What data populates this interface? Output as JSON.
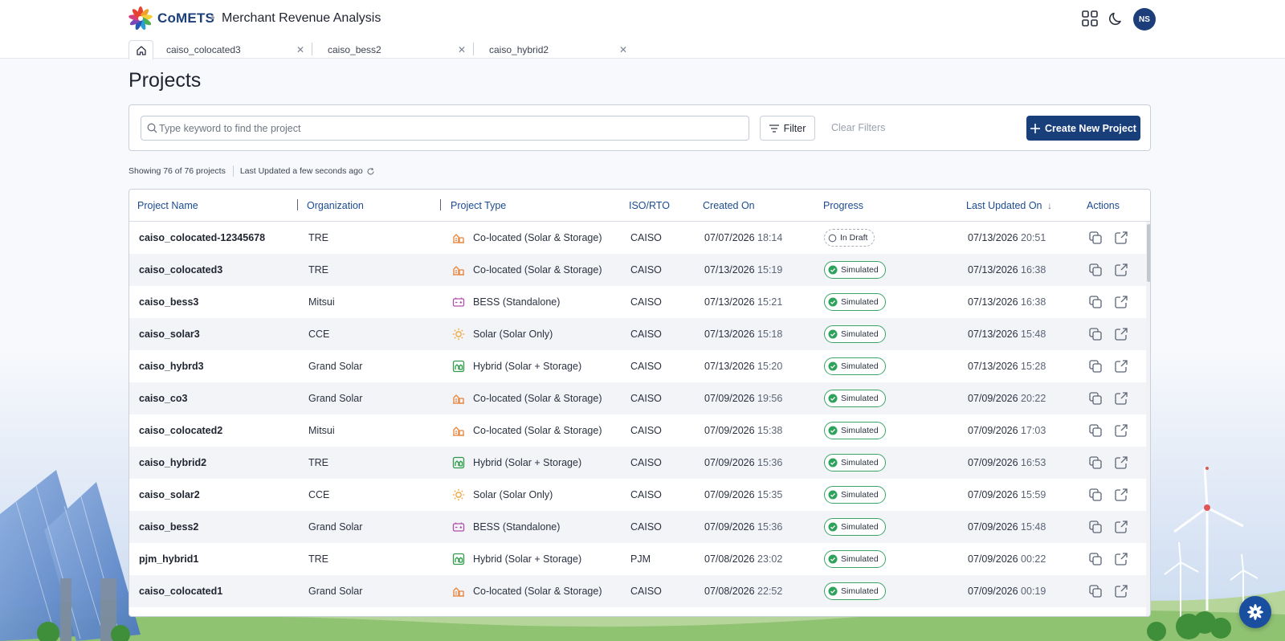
{
  "header": {
    "brand": "CoMETS",
    "app_title": "Merchant Revenue Analysis",
    "avatar_initials": "NS",
    "icons": [
      "apps-grid-icon",
      "moon-icon"
    ]
  },
  "tabs": [
    {
      "label": "caiso_colocated3"
    },
    {
      "label": "caiso_bess2"
    },
    {
      "label": "caiso_hybrid2"
    }
  ],
  "page": {
    "title": "Projects"
  },
  "toolbar": {
    "search_placeholder": "Type keyword to find the project",
    "filter_label": "Filter",
    "clear_label": "Clear Filters",
    "create_label": "Create New Project"
  },
  "meta": {
    "showing": "Showing 76 of 76 projects",
    "last_updated": "Last Updated a few seconds ago"
  },
  "table": {
    "columns": [
      "Project Name",
      "Organization",
      "Project Type",
      "ISO/RTO",
      "Created On",
      "Progress",
      "Last Updated On",
      "Actions"
    ],
    "sort": {
      "column": "Last Updated On",
      "direction": "desc"
    },
    "rows": [
      {
        "name": "caiso_colocated-12345678",
        "org": "TRE",
        "type": "Co-located (Solar & Storage)",
        "type_icon": "colocated-icon",
        "iso": "CAISO",
        "created_date": "07/07/2026",
        "created_time": "18:14",
        "progress": "In Draft",
        "updated_date": "07/13/2026",
        "updated_time": "20:51"
      },
      {
        "name": "caiso_colocated3",
        "org": "TRE",
        "type": "Co-located (Solar & Storage)",
        "type_icon": "colocated-icon",
        "iso": "CAISO",
        "created_date": "07/13/2026",
        "created_time": "15:19",
        "progress": "Simulated",
        "updated_date": "07/13/2026",
        "updated_time": "16:38"
      },
      {
        "name": "caiso_bess3",
        "org": "Mitsui",
        "type": "BESS (Standalone)",
        "type_icon": "battery-icon",
        "iso": "CAISO",
        "created_date": "07/13/2026",
        "created_time": "15:21",
        "progress": "Simulated",
        "updated_date": "07/13/2026",
        "updated_time": "16:38"
      },
      {
        "name": "caiso_solar3",
        "org": "CCE",
        "type": "Solar (Solar Only)",
        "type_icon": "sun-icon",
        "iso": "CAISO",
        "created_date": "07/13/2026",
        "created_time": "15:18",
        "progress": "Simulated",
        "updated_date": "07/13/2026",
        "updated_time": "15:48"
      },
      {
        "name": "caiso_hybrd3",
        "org": "Grand Solar",
        "type": "Hybrid (Solar + Storage)",
        "type_icon": "hybrid-icon",
        "iso": "CAISO",
        "created_date": "07/13/2026",
        "created_time": "15:20",
        "progress": "Simulated",
        "updated_date": "07/13/2026",
        "updated_time": "15:28"
      },
      {
        "name": "caiso_co3",
        "org": "Grand Solar",
        "type": "Co-located (Solar & Storage)",
        "type_icon": "colocated-icon",
        "iso": "CAISO",
        "created_date": "07/09/2026",
        "created_time": "19:56",
        "progress": "Simulated",
        "updated_date": "07/09/2026",
        "updated_time": "20:22"
      },
      {
        "name": "caiso_colocated2",
        "org": "Mitsui",
        "type": "Co-located (Solar & Storage)",
        "type_icon": "colocated-icon",
        "iso": "CAISO",
        "created_date": "07/09/2026",
        "created_time": "15:38",
        "progress": "Simulated",
        "updated_date": "07/09/2026",
        "updated_time": "17:03"
      },
      {
        "name": "caiso_hybrid2",
        "org": "TRE",
        "type": "Hybrid (Solar + Storage)",
        "type_icon": "hybrid-icon",
        "iso": "CAISO",
        "created_date": "07/09/2026",
        "created_time": "15:36",
        "progress": "Simulated",
        "updated_date": "07/09/2026",
        "updated_time": "16:53"
      },
      {
        "name": "caiso_solar2",
        "org": "CCE",
        "type": "Solar (Solar Only)",
        "type_icon": "sun-icon",
        "iso": "CAISO",
        "created_date": "07/09/2026",
        "created_time": "15:35",
        "progress": "Simulated",
        "updated_date": "07/09/2026",
        "updated_time": "15:59"
      },
      {
        "name": "caiso_bess2",
        "org": "Grand Solar",
        "type": "BESS (Standalone)",
        "type_icon": "battery-icon",
        "iso": "CAISO",
        "created_date": "07/09/2026",
        "created_time": "15:36",
        "progress": "Simulated",
        "updated_date": "07/09/2026",
        "updated_time": "15:48"
      },
      {
        "name": "pjm_hybrid1",
        "org": "TRE",
        "type": "Hybrid (Solar + Storage)",
        "type_icon": "hybrid-icon",
        "iso": "PJM",
        "created_date": "07/08/2026",
        "created_time": "23:02",
        "progress": "Simulated",
        "updated_date": "07/09/2026",
        "updated_time": "00:22"
      },
      {
        "name": "caiso_colocated1",
        "org": "Grand Solar",
        "type": "Co-located (Solar & Storage)",
        "type_icon": "colocated-icon",
        "iso": "CAISO",
        "created_date": "07/08/2026",
        "created_time": "22:52",
        "progress": "Simulated",
        "updated_date": "07/09/2026",
        "updated_time": "00:19"
      }
    ]
  },
  "colors": {
    "primary": "#183f7a",
    "link": "#1d4b8f",
    "success": "#2ea15a",
    "icon_orange": "#e8833a",
    "icon_purple": "#b04fa8",
    "icon_green": "#2f9a4a",
    "icon_sun": "#f0a43a"
  }
}
